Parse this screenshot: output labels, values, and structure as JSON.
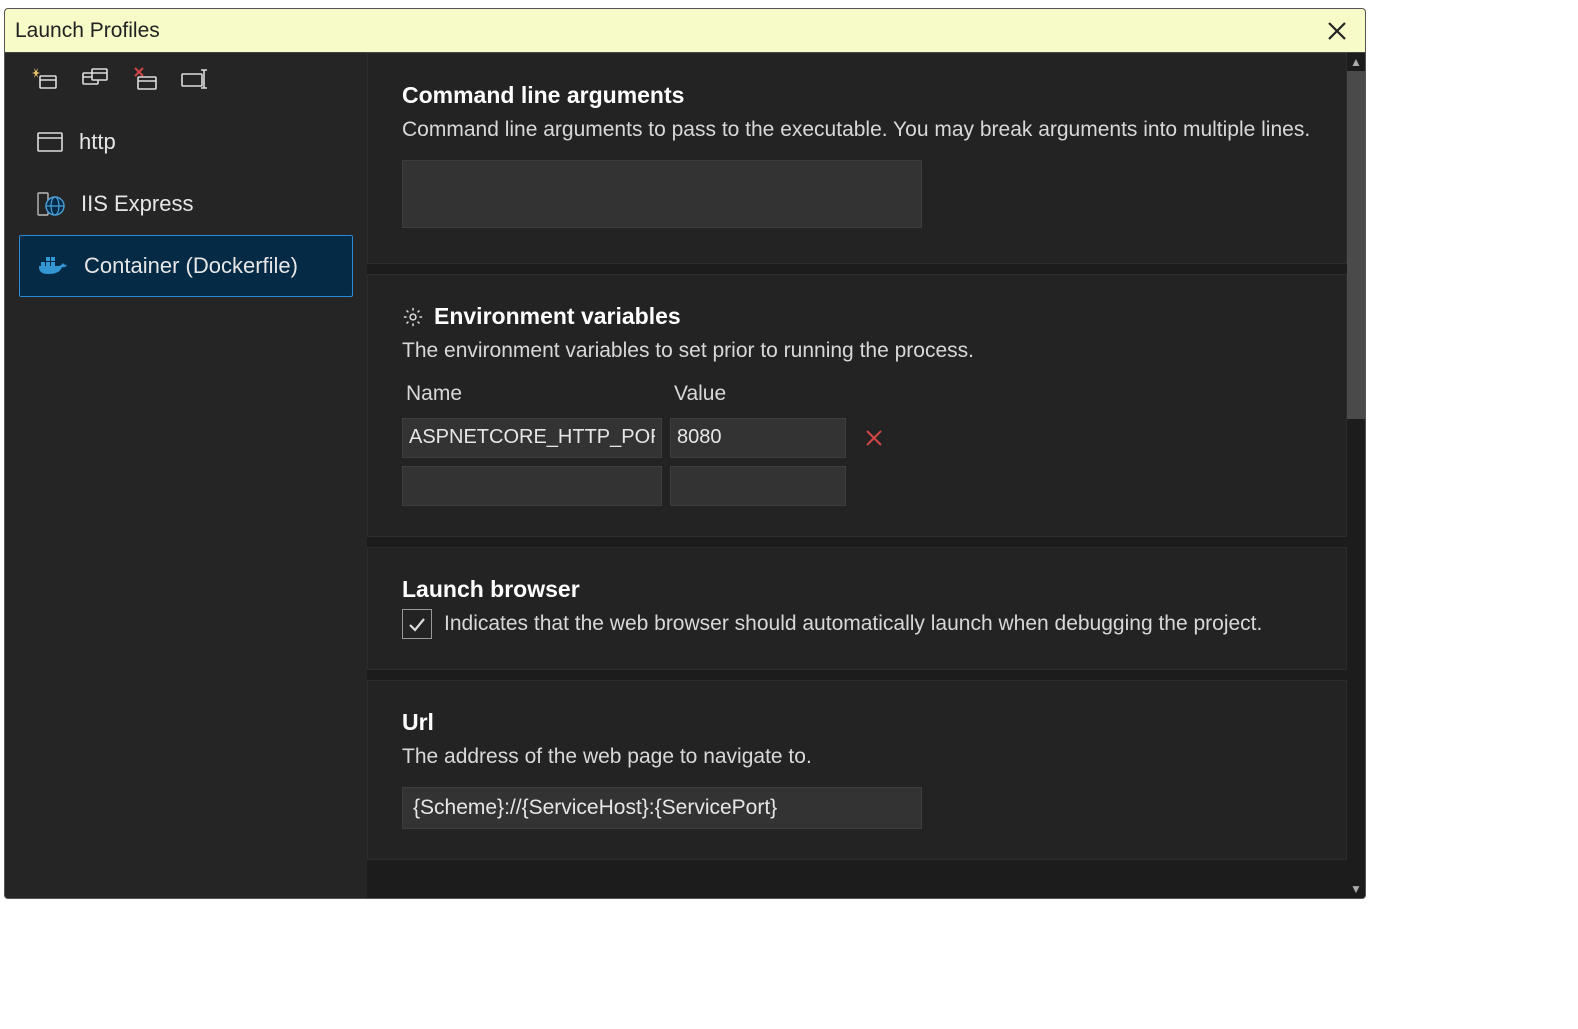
{
  "window": {
    "title": "Launch Profiles"
  },
  "sidebar": {
    "toolbar_icons": [
      "new-profile-icon",
      "duplicate-profile-icon",
      "delete-profile-icon",
      "rename-profile-icon"
    ],
    "profiles": [
      {
        "icon": "window-icon",
        "label": "http",
        "selected": false
      },
      {
        "icon": "globe-icon",
        "label": "IIS Express",
        "selected": false
      },
      {
        "icon": "docker-icon",
        "label": "Container (Dockerfile)",
        "selected": true
      }
    ]
  },
  "sections": {
    "cmdline": {
      "heading": "Command line arguments",
      "description": "Command line arguments to pass to the executable. You may break arguments into multiple lines.",
      "value": ""
    },
    "env": {
      "icon": "gear-icon",
      "heading": "Environment variables",
      "description": "The environment variables to set prior to running the process.",
      "columns": {
        "name": "Name",
        "value": "Value"
      },
      "rows": [
        {
          "name": "ASPNETCORE_HTTP_PORTS",
          "value": "8080"
        },
        {
          "name": "",
          "value": ""
        }
      ]
    },
    "launch": {
      "heading": "Launch browser",
      "checkbox_checked": true,
      "description": "Indicates that the web browser should automatically launch when debugging the project."
    },
    "url": {
      "heading": "Url",
      "description": "The address of the web page to navigate to.",
      "value": "{Scheme}://{ServiceHost}:{ServicePort}"
    }
  }
}
